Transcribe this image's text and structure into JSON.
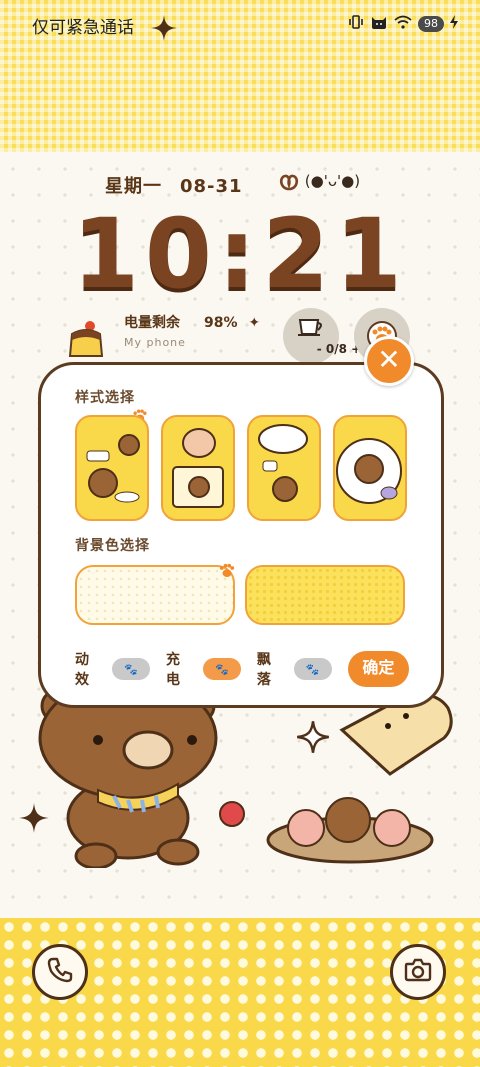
{
  "status_bar": {
    "carrier": "仅可紧急通话",
    "battery": "98"
  },
  "lockscreen": {
    "weekday": "星期一",
    "date": "08-31",
    "kaomoji": "(●'ᴗ'●)",
    "time": "10:21",
    "battery_label": "电量剩余",
    "battery_value": "98%",
    "device_name": "My phone",
    "cup_counter": "- 0/8 +"
  },
  "modal": {
    "style_section_label": "样式选择",
    "bg_section_label": "背景色选择",
    "close_label": "✕",
    "toggles": [
      {
        "label": "动效",
        "on": false
      },
      {
        "label": "充电",
        "on": true
      },
      {
        "label": "飘落",
        "on": false
      }
    ],
    "confirm_label": "确定"
  },
  "colors": {
    "accent": "#f08a2a",
    "brown": "#5c3b21",
    "yellow": "#f9d94a"
  },
  "icons": [
    "sparkle-icon",
    "vibrate-icon",
    "cat-icon",
    "wifi-icon",
    "charging-icon",
    "pretzel-icon",
    "cup-icon",
    "paw-icon",
    "phone-icon",
    "camera-icon"
  ]
}
